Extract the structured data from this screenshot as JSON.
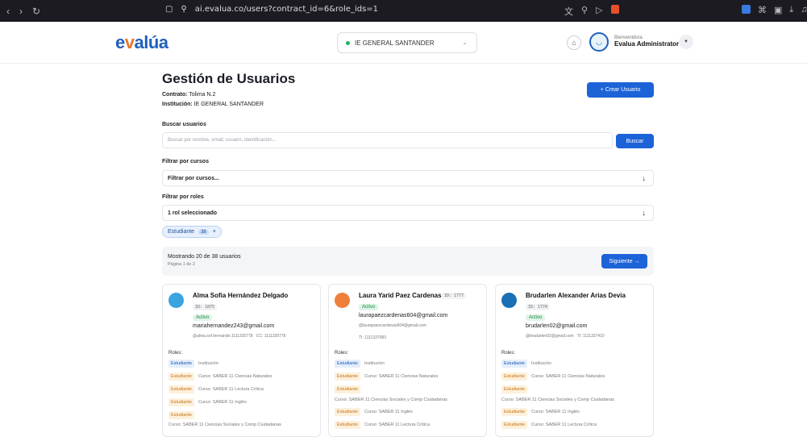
{
  "browser": {
    "url": "ai.evalua.co/users?contract_id=6&role_ids=1"
  },
  "header": {
    "logo_prefix": "e",
    "logo_o": "v",
    "logo_suffix": "alúa",
    "institution": "IE GENERAL SANTANDER",
    "welcome": "Bienvenido/a",
    "user_name": "Evalua Administrator"
  },
  "page": {
    "title": "Gestión de Usuarios",
    "contract_label": "Contrato:",
    "contract_value": "Tolima N.2",
    "institution_label": "Institución:",
    "institution_value": "IE GENERAL SANTANDER",
    "create_button": "+ Crear Usuario"
  },
  "search": {
    "label": "Buscar usuarios",
    "placeholder": "Buscar por nombre, email, usuario, identificación...",
    "button": "Buscar"
  },
  "course_filter": {
    "label": "Filtrar por cursos",
    "value": "Filtrar por cursos..."
  },
  "role_filter": {
    "label": "Filtrar por roles",
    "value": "1 rol seleccionado"
  },
  "active_chip": {
    "label": "Estudiante",
    "count": "38",
    "remove": "×"
  },
  "pagination": {
    "showing": "Mostrando 20 de 38 usuarios",
    "page": "Página 1 de 2",
    "next": "Siguiente →"
  },
  "cards": [
    {
      "name": "Alma Sofia Hernández Delgado",
      "id": "ID: 1875",
      "status": "Activo",
      "email": "mariahernandez243@gmail.com",
      "handle": "@alma.sof.hernande.1111335778",
      "doc": "CC: 1111335778",
      "roles_label": "Roles:",
      "roles": [
        {
          "tag": "Estudiante",
          "tag_color": "blue",
          "text": "Institución"
        },
        {
          "tag": "Estudiante",
          "tag_color": "orange",
          "text": "Curso: SABER 11 Ciencias Naturales"
        },
        {
          "tag": "Estudiante",
          "tag_color": "orange",
          "text": "Curso: SABER 11 Lectura Crítica"
        },
        {
          "tag": "Estudiante",
          "tag_color": "orange",
          "text": "Curso: SABER 11 Inglés"
        },
        {
          "tag": "Estudiante",
          "tag_color": "orange",
          "text": ""
        }
      ],
      "extra_line": "Curso: SABER 11 Ciencias Sociales y Comp Ciudadanas"
    },
    {
      "name": "Laura Yarid Paez Cardenas",
      "id": "ID: 1777",
      "status": "Activo",
      "email": "laurapaezcardenas604@gmail.com",
      "handle": "@laurapaezcardenas604@gmail.com",
      "doc": "TI: 1111337083",
      "roles_label": "Roles:",
      "roles": [
        {
          "tag": "Estudiante",
          "tag_color": "blue",
          "text": "Institución"
        },
        {
          "tag": "Estudiante",
          "tag_color": "orange",
          "text": "Curso: SABER 11 Ciencias Naturales"
        },
        {
          "tag": "Estudiante",
          "tag_color": "orange",
          "text": ""
        },
        {
          "tag": "",
          "tag_color": "none",
          "text": "Curso: SABER 11 Ciencias Sociales y Comp Ciudadanas"
        },
        {
          "tag": "Estudiante",
          "tag_color": "orange",
          "text": "Curso: SABER 11 Inglés"
        },
        {
          "tag": "Estudiante",
          "tag_color": "orange",
          "text": "Curso: SABER 11 Lectura Crítica"
        }
      ]
    },
    {
      "name": "Brudarlen Alexander Arias Devia",
      "id": "ID: 1770",
      "status": "Activo",
      "email": "brudarlen02@gmail.com",
      "handle": "@brudarlen02@gmail.com",
      "doc": "TI: 1111337410",
      "roles_label": "Roles:",
      "roles": [
        {
          "tag": "Estudiante",
          "tag_color": "blue",
          "text": "Institución"
        },
        {
          "tag": "Estudiante",
          "tag_color": "orange",
          "text": "Curso: SABER 11 Ciencias Naturales"
        },
        {
          "tag": "Estudiante",
          "tag_color": "orange",
          "text": ""
        },
        {
          "tag": "",
          "tag_color": "none",
          "text": "Curso: SABER 11 Ciencias Sociales y Comp Ciudadanas"
        },
        {
          "tag": "Estudiante",
          "tag_color": "orange",
          "text": "Curso: SABER 11 Inglés"
        },
        {
          "tag": "Estudiante",
          "tag_color": "orange",
          "text": "Curso: SABER 11 Lectura Crítica"
        }
      ]
    }
  ],
  "colors": {
    "primary": "#1c63d8",
    "logo_blue": "#1f5fbf",
    "logo_orange": "#e8772e",
    "active_green": "#1a8a45",
    "avatar_1": "#39a4e0",
    "avatar_2": "#f07f3a",
    "avatar_3": "#1a6fb5"
  }
}
